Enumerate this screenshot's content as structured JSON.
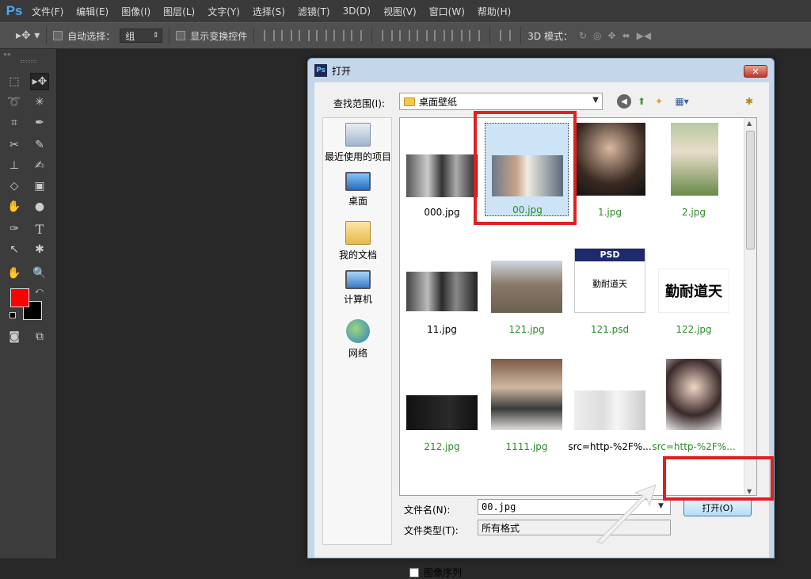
{
  "app": {
    "logo": "Ps"
  },
  "menubar": {
    "items": [
      "文件(F)",
      "编辑(E)",
      "图像(I)",
      "图层(L)",
      "文字(Y)",
      "选择(S)",
      "滤镜(T)",
      "3D(D)",
      "视图(V)",
      "窗口(W)",
      "帮助(H)"
    ]
  },
  "options": {
    "auto_select_label": "自动选择：",
    "auto_select_value": "组",
    "show_transform_label": "显示变换控件",
    "mode_3d_label": "3D 模式："
  },
  "dialog": {
    "title": "打开",
    "close_label": "✕",
    "look_in_label": "查找范围(I):",
    "look_in_value": "桌面壁纸",
    "places": [
      {
        "label": "最近使用的项目",
        "icon": "recent-items-icon"
      },
      {
        "label": "桌面",
        "icon": "desktop-icon"
      },
      {
        "label": "我的文档",
        "icon": "documents-icon"
      },
      {
        "label": "计算机",
        "icon": "computer-icon"
      },
      {
        "label": "网络",
        "icon": "network-icon"
      }
    ],
    "files": [
      {
        "name": "000.jpg",
        "color": "black"
      },
      {
        "name": "00.jpg",
        "color": "green",
        "selected": true
      },
      {
        "name": "1.jpg",
        "color": "green"
      },
      {
        "name": "2.jpg",
        "color": "green"
      },
      {
        "name": "11.jpg",
        "color": "black"
      },
      {
        "name": "121.jpg",
        "color": "green"
      },
      {
        "name": "121.psd",
        "color": "green"
      },
      {
        "name": "122.jpg",
        "color": "green"
      },
      {
        "name": "212.jpg",
        "color": "green"
      },
      {
        "name": "1111.jpg",
        "color": "green"
      },
      {
        "name": "src=http-%2F%...",
        "color": "black"
      },
      {
        "name": "src=http-%2F%...",
        "color": "green"
      }
    ],
    "psd_badge": "PSD",
    "calligraphy": "勤耐道天",
    "filename_label": "文件名(N):",
    "filename_value": "00.jpg",
    "filetype_label": "文件类型(T):",
    "filetype_value": "所有格式",
    "open_button": "打开(O)",
    "image_sequence_label": "图像序列"
  },
  "colors": {
    "foreground": "#ff0000",
    "background": "#000000",
    "highlight": "#e02020"
  }
}
